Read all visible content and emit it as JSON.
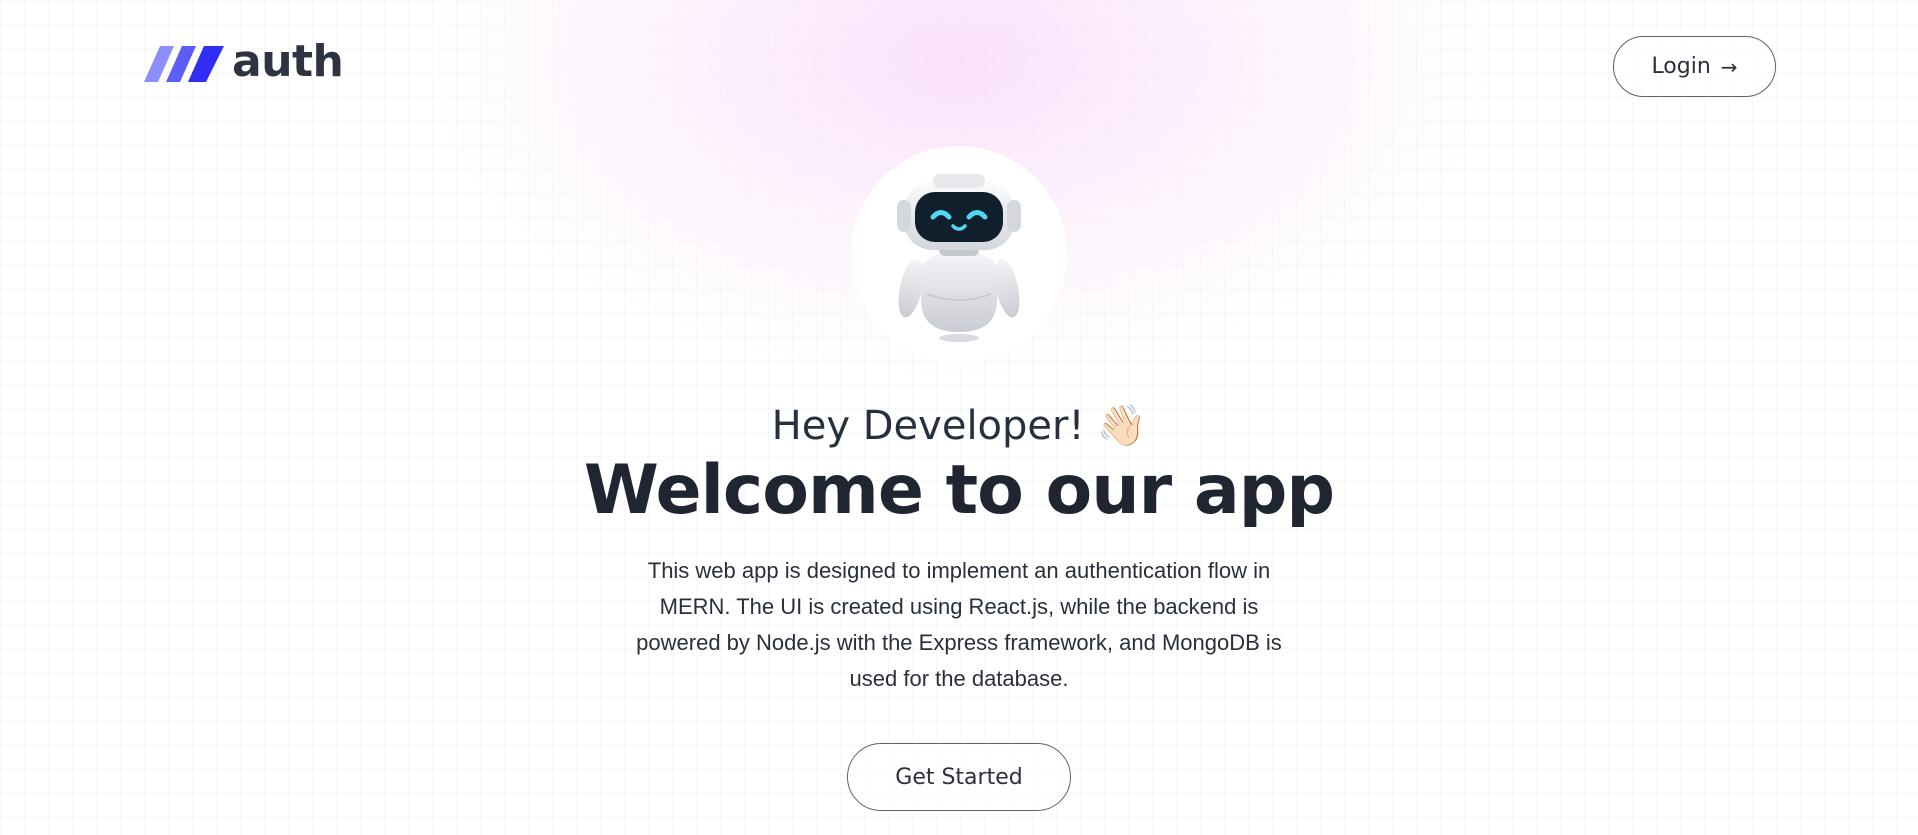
{
  "brand": {
    "name": "auth",
    "logo_icon": "three-slash-stripes-icon",
    "stripe_colors": [
      "#8b8ff7",
      "#5d5df6",
      "#2f2ef2"
    ]
  },
  "nav": {
    "login_label": "Login",
    "login_icon": "arrow-right-icon",
    "login_arrow": "→"
  },
  "hero": {
    "avatar_icon": "robot-icon",
    "greeting": "Hey Developer!",
    "greeting_emoji": "👋🏻",
    "headline": "Welcome to our app",
    "description": "This web app is designed to implement an authentication flow in MERN. The UI is created using React.js, while the backend is powered by Node.js with the Express framework, and MongoDB is used for the database.",
    "cta_label": "Get Started"
  },
  "colors": {
    "text_dark": "#1f2632",
    "button_border": "#5b6270",
    "glow_pink": "#f9d7fa",
    "robot_screen": "#0f1f2c",
    "robot_eyes": "#4fd9f0"
  }
}
